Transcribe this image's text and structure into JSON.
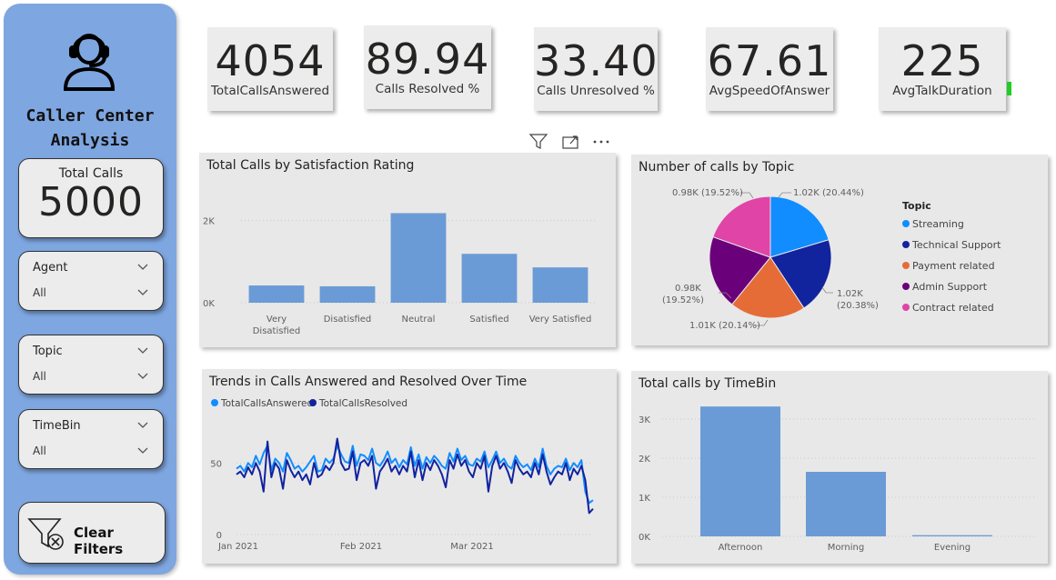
{
  "sidebar": {
    "title_line1": "Caller Center",
    "title_line2": "Analysis",
    "total_calls_label": "Total Calls",
    "total_calls_value": "5000",
    "slicers": [
      {
        "name": "Agent",
        "value": "All"
      },
      {
        "name": "Topic",
        "value": "All"
      },
      {
        "name": "TimeBin",
        "value": "All"
      }
    ],
    "clear_filters": "Clear Filters"
  },
  "kpis": [
    {
      "value": "4054",
      "label": "TotalCallsAnswered"
    },
    {
      "value": "89.94",
      "label": "Calls Resolved %"
    },
    {
      "value": "33.40",
      "label": "Calls Unresolved %"
    },
    {
      "value": "67.61",
      "label": "AvgSpeedOfAnswer"
    },
    {
      "value": "225",
      "label": "AvgTalkDuration"
    }
  ],
  "colors": {
    "bar": "#6b9bd6",
    "streaming": "#118dff",
    "technical": "#12239e",
    "payment": "#e66c37",
    "admin": "#6b007b",
    "contract": "#e044a7",
    "answered": "#118dff",
    "resolved": "#12239e"
  },
  "chart_data": [
    {
      "type": "bar",
      "title": "Total Calls by Satisfaction Rating",
      "categories": [
        "Very Dissatisfied",
        "Disatisfied",
        "Neutral",
        "Satisfied",
        "Very Satisfied"
      ],
      "category_lines": [
        [
          "Very",
          "Disatisfied"
        ],
        [
          "Disatisfied"
        ],
        [
          "Neutral"
        ],
        [
          "Satisfied"
        ],
        [
          "Very Satisfied"
        ]
      ],
      "values": [
        420,
        400,
        2180,
        1190,
        860
      ],
      "yticks": [
        {
          "v": 0,
          "label": "0K"
        },
        {
          "v": 2000,
          "label": "2K"
        }
      ],
      "ylim": [
        0,
        2500
      ]
    },
    {
      "type": "pie",
      "title": "Number of calls by Topic",
      "legend_title": "Topic",
      "slices": [
        {
          "name": "Streaming",
          "value": 1.02,
          "label": "1.02K (20.44%)",
          "color": "#118dff"
        },
        {
          "name": "Technical Support",
          "value": 1.02,
          "label": "1.02K (20.38%)",
          "color": "#12239e"
        },
        {
          "name": "Payment related",
          "value": 1.01,
          "label": "1.01K (20.14%)",
          "color": "#e66c37"
        },
        {
          "name": "Admin Support",
          "value": 0.98,
          "label": "0.98K (19.52%)",
          "color": "#6b007b"
        },
        {
          "name": "Contract related",
          "value": 0.98,
          "label": "0.98K (19.52%)",
          "color": "#e044a7"
        }
      ],
      "outer_labels": {
        "top_left": "0.98K (19.52%)",
        "top_right": "1.02K (20.44%)",
        "left_1": "0.98K",
        "left_2": "(19.52%)",
        "right_1": "1.02K",
        "right_2": "(20.38%)",
        "bottom": "1.01K (20.14%)"
      }
    },
    {
      "type": "line",
      "title": "Trends in Calls Answered and Resolved Over Time",
      "xticks": [
        "Jan 2021",
        "Feb 2021",
        "Mar 2021"
      ],
      "yticks": [
        {
          "v": 0,
          "label": "0"
        },
        {
          "v": 50,
          "label": "50"
        }
      ],
      "ylim": [
        0,
        80
      ],
      "series": [
        {
          "name": "TotalCallsAnswered",
          "color": "#118dff",
          "values": [
            46,
            48,
            44,
            50,
            47,
            55,
            49,
            57,
            62,
            45,
            53,
            50,
            44,
            57,
            52,
            46,
            48,
            44,
            47,
            51,
            55,
            44,
            45,
            53,
            50,
            53,
            62,
            56,
            51,
            50,
            62,
            48,
            56,
            55,
            52,
            60,
            50,
            48,
            52,
            58,
            50,
            53,
            47,
            52,
            49,
            61,
            48,
            56,
            46,
            54,
            50,
            55,
            52,
            48,
            46,
            57,
            51,
            60,
            52,
            55,
            49,
            48,
            53,
            51,
            58,
            47,
            52,
            58,
            50,
            53,
            48,
            46,
            55,
            50,
            47,
            49,
            45,
            53,
            47,
            60,
            48,
            42,
            46,
            48,
            47,
            53,
            45,
            50,
            47,
            52,
            30,
            22,
            24
          ]
        },
        {
          "name": "TotalCallsResolved",
          "color": "#12239e",
          "values": [
            42,
            44,
            40,
            47,
            42,
            50,
            44,
            30,
            65,
            40,
            50,
            46,
            32,
            52,
            45,
            40,
            44,
            38,
            42,
            35,
            50,
            40,
            42,
            48,
            45,
            50,
            67,
            50,
            45,
            46,
            58,
            38,
            50,
            52,
            48,
            55,
            32,
            44,
            48,
            53,
            44,
            48,
            42,
            48,
            44,
            58,
            40,
            52,
            38,
            50,
            45,
            52,
            48,
            42,
            33,
            52,
            46,
            56,
            48,
            52,
            44,
            40,
            50,
            46,
            55,
            30,
            48,
            55,
            46,
            50,
            44,
            36,
            52,
            46,
            42,
            44,
            40,
            50,
            42,
            56,
            44,
            35,
            40,
            44,
            42,
            50,
            38,
            46,
            42,
            48,
            38,
            15,
            18
          ]
        }
      ]
    },
    {
      "type": "bar",
      "title": "Total calls by TimeBin",
      "categories": [
        "Afternoon",
        "Morning",
        "Evening"
      ],
      "values": [
        3320,
        1650,
        30
      ],
      "yticks": [
        {
          "v": 0,
          "label": "0K"
        },
        {
          "v": 1000,
          "label": "1K"
        },
        {
          "v": 2000,
          "label": "2K"
        },
        {
          "v": 3000,
          "label": "3K"
        }
      ],
      "ylim": [
        0,
        3300
      ]
    }
  ]
}
